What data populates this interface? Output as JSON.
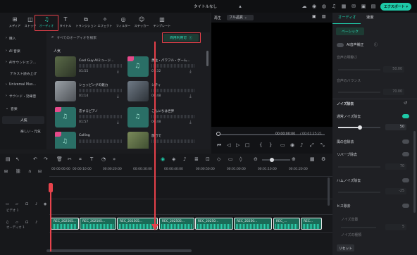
{
  "window": {
    "title": "タイトルなし"
  },
  "top_right": {
    "export_label": "エクスポート"
  },
  "toolbar": {
    "items": [
      {
        "label": "メディア",
        "icon": "media-icon"
      },
      {
        "label": "ストック",
        "icon": "stock-icon"
      },
      {
        "label": "オーディオ",
        "icon": "audio-note-icon"
      },
      {
        "label": "タイトル",
        "icon": "title-t-icon"
      },
      {
        "label": "トランジション",
        "icon": "transition-icon"
      },
      {
        "label": "エフェクト",
        "icon": "effect-icon"
      },
      {
        "label": "フィルター",
        "icon": "filter-icon"
      },
      {
        "label": "ステッカー",
        "icon": "sticker-icon"
      },
      {
        "label": "テンプレート",
        "icon": "template-icon"
      }
    ],
    "active": "オーディオ"
  },
  "sidebar": {
    "items": [
      {
        "label": "購入",
        "icon": "chevron-right-icon"
      },
      {
        "label": "AI 音楽",
        "icon": "chevron-right-icon"
      },
      {
        "label": "AIサウンドエフ...",
        "icon": "chevron-right-icon"
      },
      {
        "label": "テキスト読み上げ",
        "icon": ""
      },
      {
        "label": "Universal Mus...",
        "icon": "chevron-right-icon"
      },
      {
        "label": "サウンド・効果音",
        "icon": "chevron-right-icon"
      },
      {
        "label": "音楽",
        "icon": "chevron-down-icon"
      },
      {
        "label": "人気",
        "icon": ""
      },
      {
        "label": "楽しい・元気",
        "icon": ""
      }
    ]
  },
  "library": {
    "search_placeholder": "すべてのオーディオを検索",
    "filter_label": "商用利用可",
    "section_title": "人気",
    "cards": [
      {
        "title": "Cool Guy-AIミュージ...",
        "duration": "01:55"
      },
      {
        "title": "勇往・パワフル・ゲーム...",
        "duration": "01:32"
      },
      {
        "title": "ショッピングの魅力",
        "duration": "01:14"
      },
      {
        "title": "シティ",
        "duration": "00:48"
      },
      {
        "title": "恋するピアノ",
        "duration": "01:57"
      },
      {
        "title": "こんにちは世界",
        "duration": "06:48"
      },
      {
        "title": "Calling",
        "duration": ""
      },
      {
        "title": "旅行で",
        "duration": ""
      }
    ]
  },
  "preview": {
    "tab1": "再生",
    "tab2": "フル品質",
    "current_time": "00:00:00:00",
    "total_time": "/ 00:01:25:21"
  },
  "timeline": {
    "ruler": [
      "00:00:00:00",
      "00:00:10:00",
      "00:00:20:00",
      "00:00:30:00",
      "00:00:40:00",
      "00:00:50:00",
      "00:01:00:00",
      "00:01:10:00",
      "00:01:20:00"
    ],
    "tracks": [
      {
        "label": "ビデオ 1"
      },
      {
        "label": "オーディオ 1"
      }
    ],
    "clip_labels": [
      "REC_202505...",
      "REC_202505...",
      "REC_202505...",
      "REC_202505...",
      "REC_20250...",
      "REC_20250...",
      "REC_...",
      "REC..."
    ]
  },
  "right_panel": {
    "tabs": [
      "オーディオ",
      "速度"
    ],
    "subtab": "ベーシック",
    "ai_enhance": "AI音声補正",
    "ai_param_1": "音声の明瞭さ",
    "ai_value_1": "50.00",
    "ai_param_2": "音声のバランス",
    "ai_value_2": "70.00",
    "noise_section": "ノイズ除去",
    "normal_noise": "通常ノイズ除去",
    "normal_noise_value": "50",
    "wind_noise": "風の音除去",
    "reverb": "リバーブ除去",
    "reverb_value": "70",
    "hum": "ハムノイズ除去",
    "hum_value": "-25",
    "hiss": "ヒス除去",
    "hiss_sub1": "ノイズ音量",
    "hiss_value": "5",
    "hiss_sub2": "ノイズの種類",
    "reset": "リセット",
    "accent_color": "#1ec9a7"
  }
}
